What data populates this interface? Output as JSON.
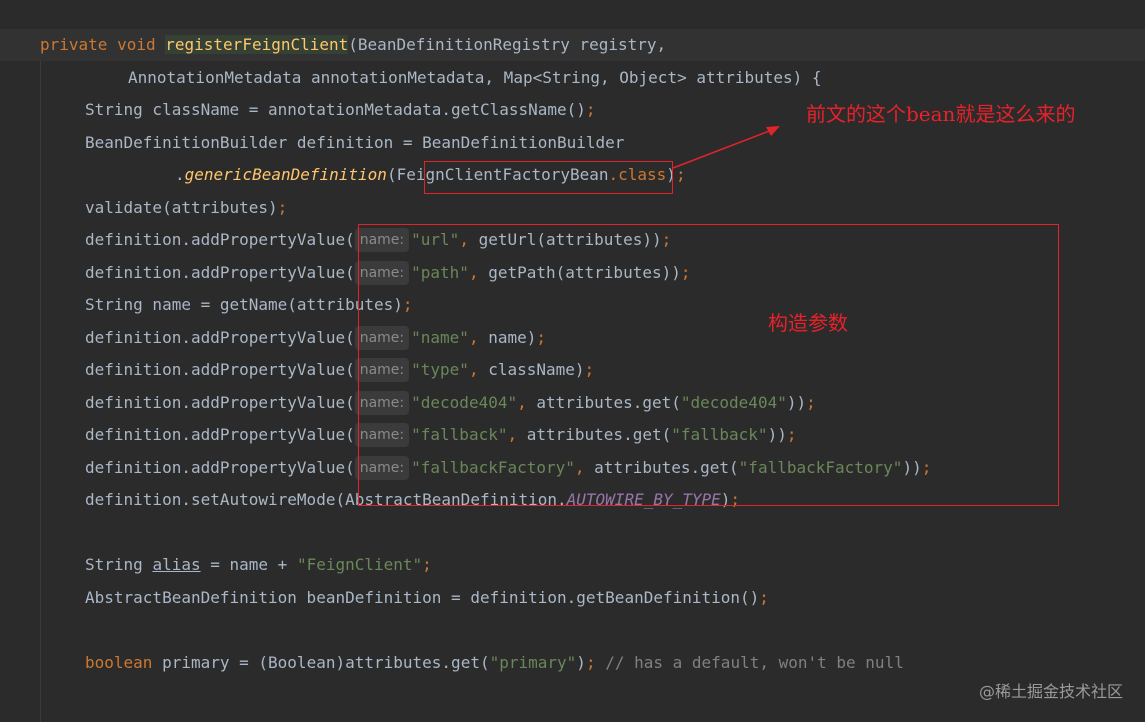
{
  "code": {
    "l1": {
      "t1": "private",
      "t2": "void",
      "t3": "registerFeignClient",
      "t4": "(BeanDefinitionRegistry registry,"
    },
    "l2": {
      "t1": "AnnotationMetadata annotationMetadata, Map<String, Object> attributes) {"
    },
    "l3": {
      "t1": "String className = annotationMetadata.getClassName()",
      "t2": ";"
    },
    "l4": {
      "t1": "BeanDefinitionBuilder definition = BeanDefinitionBuilder"
    },
    "l5": {
      "t1": ".",
      "t2": "genericBeanDefinition",
      "t3": "(",
      "t4": "FeignClientFactoryBean",
      "t5": ".class",
      "t6": ")",
      "t7": ";"
    },
    "l6": {
      "t1": "validate(attributes)",
      "t2": ";"
    },
    "l7": {
      "t1": "definition.addPropertyValue(",
      "hint": "name:",
      "t2": "\"url\"",
      "t3": ", ",
      "t4": "getUrl(attributes))",
      "t5": ";"
    },
    "l8": {
      "t1": "definition.addPropertyValue(",
      "hint": "name:",
      "t2": "\"path\"",
      "t3": ", ",
      "t4": "getPath(attributes))",
      "t5": ";"
    },
    "l9": {
      "t1": "String name = getName(attributes)",
      "t2": ";"
    },
    "l10": {
      "t1": "definition.addPropertyValue(",
      "hint": "name:",
      "t2": "\"name\"",
      "t3": ", ",
      "t4": "name)",
      "t5": ";"
    },
    "l11": {
      "t1": "definition.addPropertyValue(",
      "hint": "name:",
      "t2": "\"type\"",
      "t3": ", ",
      "t4": "className)",
      "t5": ";"
    },
    "l12": {
      "t1": "definition.addPropertyValue(",
      "hint": "name:",
      "t2": "\"decode404\"",
      "t3": ", ",
      "t4": "attributes.get(",
      "t5": "\"decode404\"",
      "t6": "))",
      "t7": ";"
    },
    "l13": {
      "t1": "definition.addPropertyValue(",
      "hint": "name:",
      "t2": "\"fallback\"",
      "t3": ", ",
      "t4": "attributes.get(",
      "t5": "\"fallback\"",
      "t6": "))",
      "t7": ";"
    },
    "l14": {
      "t1": "definition.addPropertyValue(",
      "hint": "name:",
      "t2": "\"fallbackFactory\"",
      "t3": ", ",
      "t4": "attributes.get(",
      "t5": "\"fallbackFactory\"",
      "t6": "))",
      "t7": ";"
    },
    "l15": {
      "t1": "definition.setAutowireMode(AbstractBeanDefinition.",
      "t2": "AUTOWIRE_BY_TYPE",
      "t3": ")",
      "t4": ";"
    },
    "l16": {
      "t1": "String ",
      "t2": "alias",
      "t3": " = name + ",
      "t4": "\"FeignClient\"",
      "t5": ";"
    },
    "l17": {
      "t1": "AbstractBeanDefinition beanDefinition = definition.getBeanDefinition()",
      "t2": ";"
    },
    "l18": {
      "t1": "boolean",
      "t2": " primary = (Boolean)attributes.get(",
      "t3": "\"primary\"",
      "t4": ")",
      "t5": ";",
      "t6": " // has a default, won't be null"
    }
  },
  "annotations": {
    "bean_note": "前文的这个bean就是这么来的",
    "params_note": "构造参数"
  },
  "watermark": "@稀土掘金技术社区",
  "colors": {
    "background": "#2b2b2b",
    "keyword": "#cc7832",
    "method": "#ffc66d",
    "string": "#6a8759",
    "comment": "#808080",
    "constant": "#9876aa",
    "annotation_red": "#e0242a"
  }
}
